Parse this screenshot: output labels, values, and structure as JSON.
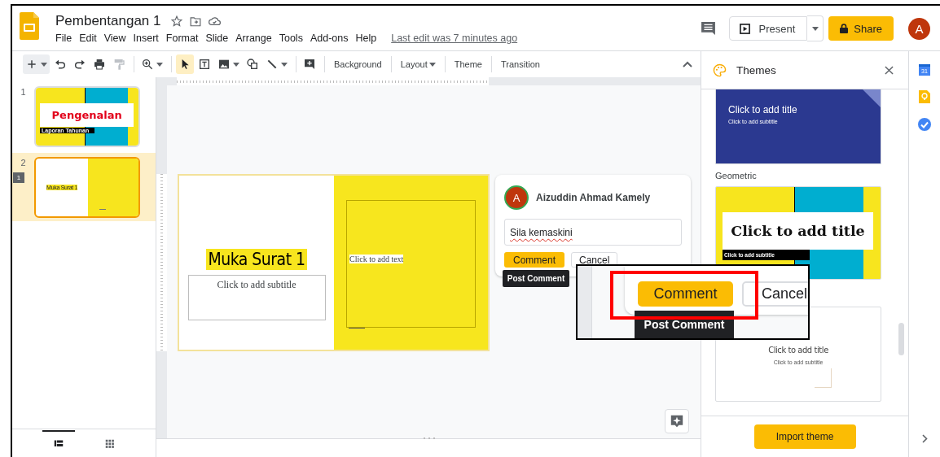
{
  "header": {
    "title": "Pembentangan 1",
    "menu": [
      "File",
      "Edit",
      "View",
      "Insert",
      "Format",
      "Slide",
      "Arrange",
      "Tools",
      "Add-ons",
      "Help"
    ],
    "last_edit": "Last edit was 7 minutes ago",
    "present": "Present",
    "share": "Share",
    "avatar": "A"
  },
  "toolbar": {
    "tools": [
      {
        "kind": "add",
        "selected": false
      },
      {
        "kind": "undo",
        "selected": false
      },
      {
        "kind": "redo",
        "selected": false
      },
      {
        "kind": "print",
        "selected": false
      },
      {
        "kind": "paint",
        "selected": false
      },
      {
        "kind": "zoom",
        "selected": false
      },
      {
        "kind": "select",
        "selected": true
      },
      {
        "kind": "textbox",
        "selected": false
      },
      {
        "kind": "image",
        "selected": false
      },
      {
        "kind": "shape",
        "selected": false
      },
      {
        "kind": "line",
        "selected": false
      },
      {
        "kind": "comment",
        "selected": false
      }
    ],
    "buttons": [
      {
        "label": "Background",
        "kind": "button"
      },
      {
        "label": "Layout",
        "kind": "menu"
      },
      {
        "label": "Theme",
        "kind": "button"
      },
      {
        "label": "Transition",
        "kind": "button"
      }
    ]
  },
  "filmstrip": {
    "slides": [
      {
        "number": "1",
        "selected": false,
        "kind": "title",
        "title": "Pengenalan",
        "subtitle": "Laporan Tahunan"
      },
      {
        "number": "2",
        "selected": true,
        "kind": "split",
        "title": "Muka Surat 1",
        "comments": "1"
      }
    ],
    "views": [
      {
        "kind": "list",
        "selected": true
      },
      {
        "kind": "grid",
        "selected": false
      }
    ]
  },
  "slide": {
    "title": "Muka Surat 1",
    "subtitle_placeholder": "Click to add subtitle",
    "body_placeholder": "Click to add text"
  },
  "comment": {
    "avatar": "A",
    "author": "Aizuddin Ahmad Kamely",
    "value": "Sila kemaskini",
    "buttons": [
      "Comment",
      "Cancel"
    ],
    "tooltip": "Post Comment"
  },
  "zoom_inset": {
    "buttons": [
      "Comment",
      "Cancel"
    ],
    "tooltip": "Post Comment"
  },
  "themes_panel": {
    "title": "Themes",
    "themes": [
      {
        "kind": "dark",
        "title": "Click to add title",
        "subtitle": "Click to add subtitle"
      },
      {
        "kind": "geometric",
        "name": "Geometric",
        "title": "Click to add title",
        "subtitle": "Click to add subtitle"
      },
      {
        "kind": "light",
        "title": "Click to add title",
        "subtitle": "Click to add subtitle"
      }
    ],
    "import_button": "Import theme"
  },
  "side_rail": {
    "calendar_day": "31"
  }
}
